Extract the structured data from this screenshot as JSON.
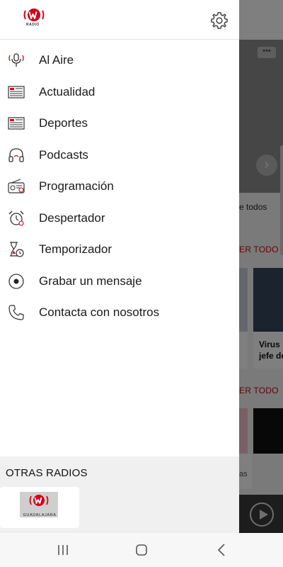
{
  "app": {
    "logo_text": "RADIO",
    "brand_color": "#d0021b"
  },
  "menu": {
    "items": [
      {
        "label": "Al Aire",
        "icon": "microphone-icon"
      },
      {
        "label": "Actualidad",
        "icon": "newspaper-icon"
      },
      {
        "label": "Deportes",
        "icon": "newspaper-icon"
      },
      {
        "label": "Podcasts",
        "icon": "headphones-icon"
      },
      {
        "label": "Programación",
        "icon": "radio-icon"
      },
      {
        "label": "Despertador",
        "icon": "alarm-clock-icon"
      },
      {
        "label": "Temporizador",
        "icon": "hourglass-icon"
      },
      {
        "label": "Grabar un mensaje",
        "icon": "record-icon"
      },
      {
        "label": "Contacta con nosotros",
        "icon": "phone-icon"
      }
    ]
  },
  "other_radios": {
    "title": "OTRAS RADIOS",
    "stations": [
      {
        "name": "GUADALAJARA"
      }
    ]
  },
  "background": {
    "text_snippet": "e todos",
    "section1_link": "ER TODO",
    "section2_link": "ER TODO",
    "card_text": "Virus p\njefe de",
    "card_tail": "as"
  }
}
